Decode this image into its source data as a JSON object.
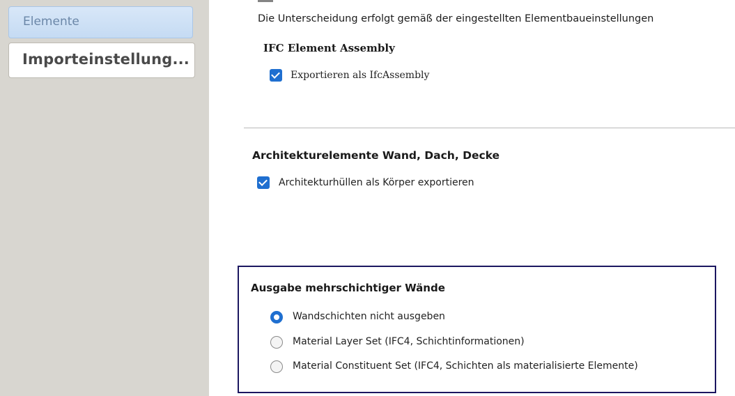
{
  "sidebar": {
    "items": [
      {
        "label": "Elemente",
        "selected": true
      },
      {
        "label": "Importeinstellung...",
        "selected": false
      }
    ]
  },
  "main": {
    "description": "Die Unterscheidung erfolgt gemäß der eingestellten Elementbaueinstellungen",
    "ifc_assembly": {
      "heading": "IFC Element Assembly",
      "checkbox_label": "Exportieren als IfcAssembly",
      "checked": true
    },
    "architecture": {
      "heading": "Architekturelemente Wand, Dach, Decke",
      "checkbox_label": "Architekturhüllen als Körper exportieren",
      "checked": true
    },
    "layered_walls": {
      "heading": "Ausgabe mehrschichtiger Wände",
      "options": [
        {
          "label": "Wandschichten nicht ausgeben",
          "selected": true
        },
        {
          "label": "Material Layer Set (IFC4, Schichtinformationen)",
          "selected": false
        },
        {
          "label": "Material Constituent Set (IFC4, Schichten als materialisierte Elemente)",
          "selected": false
        }
      ]
    }
  },
  "colors": {
    "accent": "#1f6fd0",
    "highlight_border": "#1b1660",
    "sidebar_bg": "#d8d6d0",
    "selected_item_bg": "#c5dbf3"
  }
}
